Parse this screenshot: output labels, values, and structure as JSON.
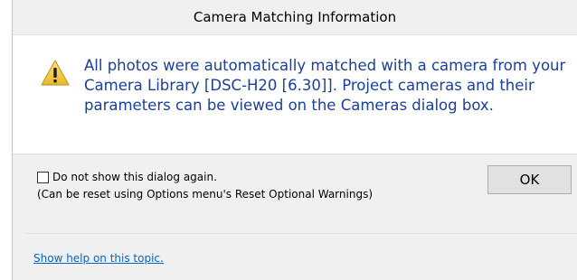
{
  "dialog": {
    "title": "Camera Matching Information",
    "icon": "warning-icon",
    "message": "All photos were automatically matched with a camera from your Camera Library [DSC-H20 [6.30]]. Project cameras and their parameters can be viewed on the Cameras dialog box.",
    "checkbox_label": "Do not show this dialog again.",
    "checkbox_checked": false,
    "checkbox_note": "(Can be reset using Options menu's Reset Optional Warnings)",
    "ok_label": "OK",
    "help_link": "Show help on this topic."
  },
  "colors": {
    "message_text": "#1a3f9c",
    "link": "#0066cc",
    "footer_bg": "#f0f0f0",
    "titlebar_bg": "#f0f0f0",
    "warning_fill": "#f2c94c"
  }
}
